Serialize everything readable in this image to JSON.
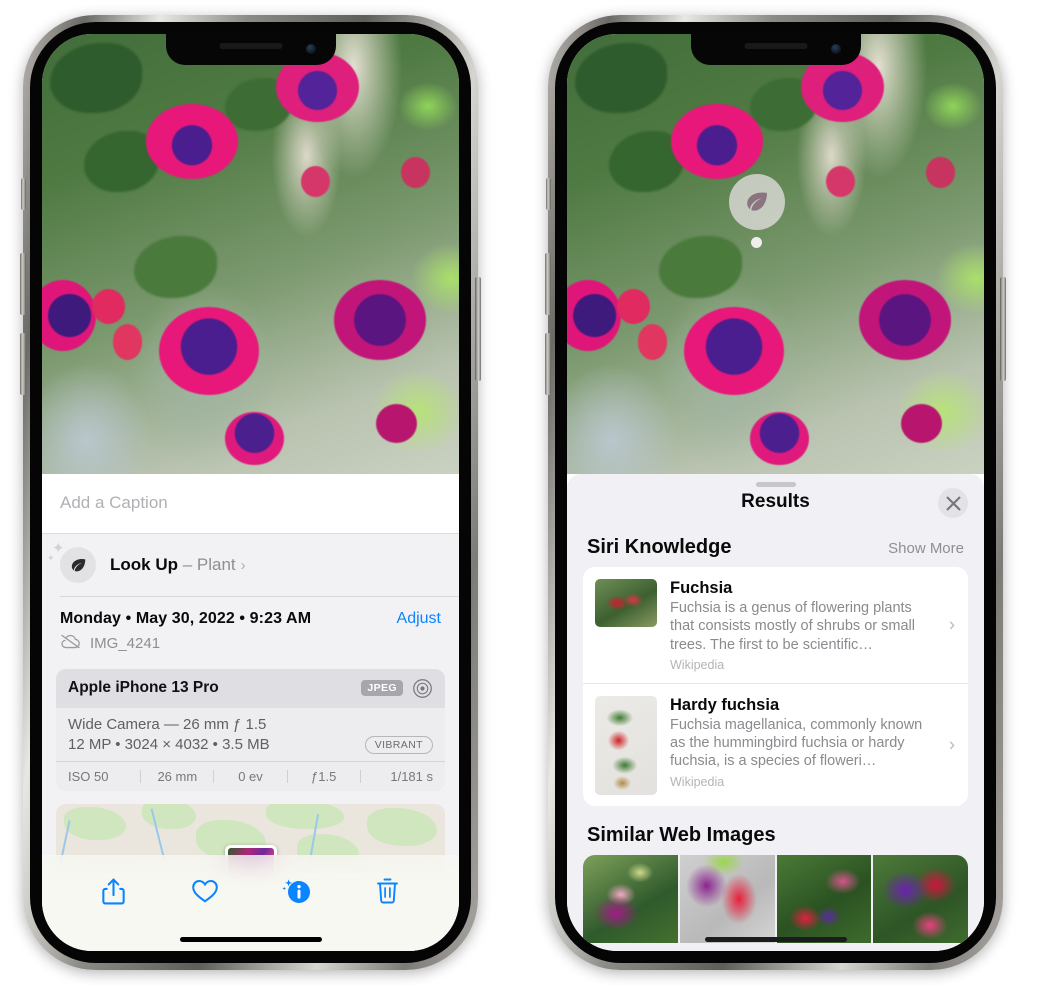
{
  "left_phone": {
    "photo_alt": "fuchsia-flowers-photo",
    "caption": {
      "placeholder": "Add a Caption",
      "value": ""
    },
    "lookup_row": {
      "icon": "leaf-icon",
      "sparkle_icon": "sparkle-icon",
      "label": "Look Up",
      "dash": " – ",
      "subject": "Plant",
      "chevron": "›"
    },
    "date_row": {
      "date": "Monday • May 30, 2022 • 9:23 AM",
      "adjust_label": "Adjust"
    },
    "file_row": {
      "icon": "cloud-slash-icon",
      "filename": "IMG_4241"
    },
    "camera_card": {
      "model": "Apple iPhone 13 Pro",
      "format_badge": "JPEG",
      "aperture_icon": "aperture-icon",
      "lens_line": "Wide Camera — 26 mm ƒ 1.5",
      "specs_line": "12 MP • 3024 × 4032 • 3.5 MB",
      "style_badge": "VIBRANT",
      "exif": [
        "ISO 50",
        "26 mm",
        "0 ev",
        "ƒ1.5",
        "1/181 s"
      ]
    },
    "map": {
      "label": "photo-location-map"
    },
    "toolbar": [
      {
        "name": "share-button",
        "icon": "share-icon"
      },
      {
        "name": "favorite-button",
        "icon": "heart-icon"
      },
      {
        "name": "info-button",
        "icon": "info-sparkle-icon"
      },
      {
        "name": "delete-button",
        "icon": "trash-icon"
      }
    ]
  },
  "right_phone": {
    "badge": {
      "icon": "leaf-icon",
      "name": "visual-look-up-badge"
    },
    "sheet": {
      "title": "Results",
      "close_icon": "close-icon",
      "sections": [
        {
          "title": "Siri Knowledge",
          "action": "Show More",
          "items": [
            {
              "thumb": "fuchsia-thumbnail",
              "title": "Fuchsia",
              "desc": "Fuchsia is a genus of flowering plants that consists mostly of shrubs or small trees. The first to be scientific…",
              "source": "Wikipedia",
              "chevron": "›"
            },
            {
              "thumb": "hardy-fuchsia-thumbnail",
              "title": "Hardy fuchsia",
              "desc": "Fuchsia magellanica, commonly known as the hummingbird fuchsia or hardy fuchsia, is a species of floweri…",
              "source": "Wikipedia",
              "chevron": "›"
            }
          ]
        },
        {
          "title": "Similar Web Images",
          "action": "",
          "images": [
            {
              "name": "web-image-1"
            },
            {
              "name": "web-image-2"
            },
            {
              "name": "web-image-3"
            },
            {
              "name": "web-image-4"
            }
          ]
        }
      ]
    }
  },
  "colors": {
    "accent_blue": "#0a84ff",
    "sheet_bg": "#f1f1f5",
    "card_bg": "#ffffff",
    "secondary_text": "#8e8e93"
  }
}
